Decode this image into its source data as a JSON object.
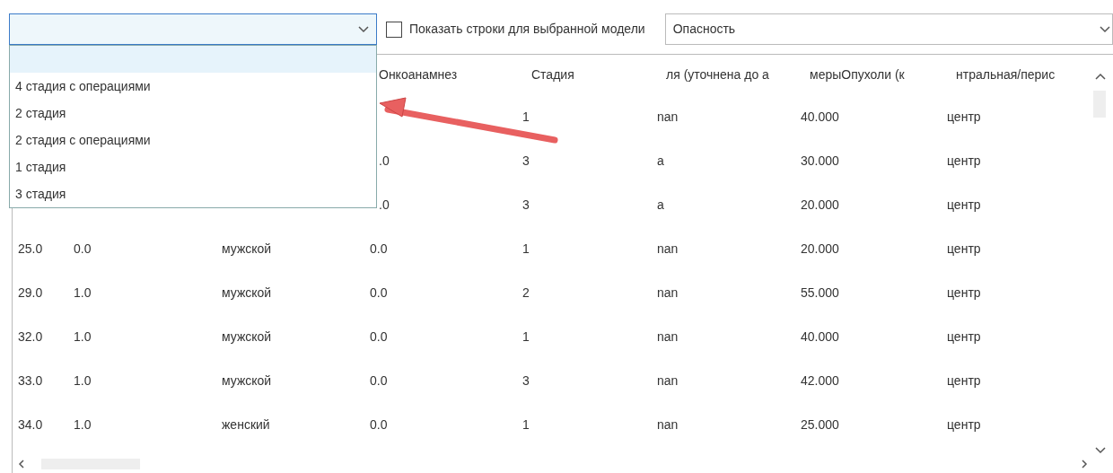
{
  "model_combo": {
    "expanded": true,
    "options": [
      {
        "selected": true
      },
      {
        "label": "4 стадия с операциями",
        "selected": false
      },
      {
        "label": "2 стадия",
        "selected": false
      },
      {
        "label": "2 стадия с операциями",
        "selected": false
      },
      {
        "label": "1 стадия",
        "selected": false
      },
      {
        "label": "3 стадия",
        "selected": false
      }
    ]
  },
  "show_rows_checkbox": {
    "label": "Показать строки для выбранной модели",
    "checked": false
  },
  "target_combo": {
    "value": "Опасность"
  },
  "table": {
    "columns": [
      null,
      null,
      null,
      "Онкоанамнез",
      "Стадия",
      "ля (уточнена до а",
      "мерыОпухоли (к",
      "нтральная/перис"
    ],
    "rows": [
      {
        "cells": [
          null,
          null,
          null,
          null,
          "1",
          "nan",
          "40.000",
          "центр"
        ]
      },
      {
        "cells": [
          null,
          null,
          null,
          ".0",
          "3",
          "а",
          "30.000",
          "центр"
        ]
      },
      {
        "cells": [
          null,
          null,
          null,
          ".0",
          "3",
          "а",
          "20.000",
          "центр"
        ]
      },
      {
        "cells": [
          "25.0",
          "0.0",
          "мужской",
          "0.0",
          "1",
          "nan",
          "20.000",
          "центр"
        ]
      },
      {
        "cells": [
          "29.0",
          "1.0",
          "мужской",
          "0.0",
          "2",
          "nan",
          "55.000",
          "центр"
        ]
      },
      {
        "cells": [
          "32.0",
          "1.0",
          "мужской",
          "0.0",
          "1",
          "nan",
          "40.000",
          "центр"
        ]
      },
      {
        "cells": [
          "33.0",
          "1.0",
          "мужской",
          "0.0",
          "3",
          "nan",
          "42.000",
          "центр"
        ]
      },
      {
        "cells": [
          "34.0",
          "1.0",
          "женский",
          "0.0",
          "1",
          "nan",
          "25.000",
          "центр"
        ]
      }
    ]
  }
}
